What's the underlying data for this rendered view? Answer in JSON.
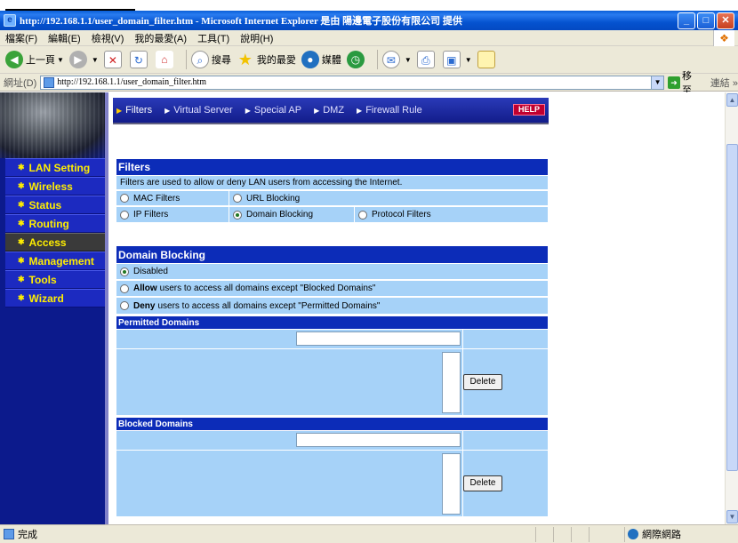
{
  "window": {
    "title": "http://192.168.1.1/user_domain_filter.htm - Microsoft Internet Explorer 是由 陽邊電子股份有限公司 提供",
    "minimize": "_",
    "maximize": "□",
    "close": "✕"
  },
  "menu": [
    "檔案(F)",
    "編輯(E)",
    "檢視(V)",
    "我的最愛(A)",
    "工具(T)",
    "說明(H)"
  ],
  "toolbar": {
    "back": "上一頁",
    "search": "搜尋",
    "favorites": "我的最愛",
    "media": "媒體"
  },
  "address": {
    "label": "網址(D)",
    "url": "http://192.168.1.1/user_domain_filter.htm",
    "go": "移至",
    "links": "連結 »"
  },
  "sidebar": {
    "items": [
      {
        "label": "LAN Setting",
        "active": false
      },
      {
        "label": "Wireless",
        "active": false
      },
      {
        "label": "Status",
        "active": false
      },
      {
        "label": "Routing",
        "active": false
      },
      {
        "label": "Access",
        "active": true
      },
      {
        "label": "Management",
        "active": false
      },
      {
        "label": "Tools",
        "active": false
      },
      {
        "label": "Wizard",
        "active": false
      }
    ]
  },
  "topnav": {
    "items": [
      "Filters",
      "Virtual Server",
      "Special AP",
      "DMZ",
      "Firewall Rule"
    ],
    "help": "HELP"
  },
  "filters": {
    "title": "Filters",
    "description": "Filters are used to allow or deny LAN users from accessing the Internet.",
    "options": {
      "mac": "MAC Filters",
      "url": "URL Blocking",
      "ip": "IP Filters",
      "domain": "Domain Blocking",
      "protocol": "Protocol Filters"
    },
    "selected": "domain"
  },
  "domain_blocking": {
    "title": "Domain Blocking",
    "disabled": "Disabled",
    "allow_bold": "Allow",
    "allow_rest": "users to access all domains except \"Blocked Domains\"",
    "deny_bold": "Deny",
    "deny_rest": "users to access all domains except \"Permitted Domains\"",
    "selected": "disabled"
  },
  "permitted": {
    "title": "Permitted Domains",
    "input_value": "",
    "delete": "Delete"
  },
  "blocked": {
    "title": "Blocked Domains",
    "input_value": "",
    "delete": "Delete"
  },
  "status": {
    "done": "完成",
    "zone": "網際網路"
  }
}
